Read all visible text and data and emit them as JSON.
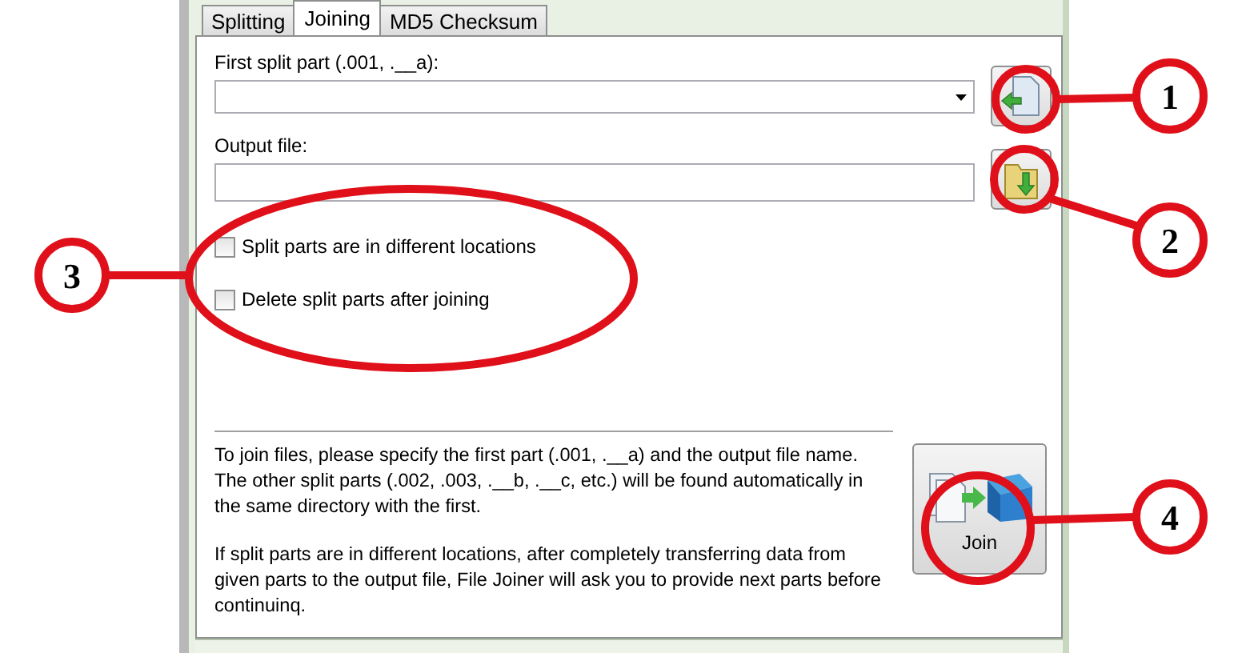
{
  "tabs": [
    {
      "label": "Splitting",
      "selected": false
    },
    {
      "label": "Joining",
      "selected": true
    },
    {
      "label": "MD5 Checksum",
      "selected": false
    }
  ],
  "first_part": {
    "label": "First split part (.001, .__a):"
  },
  "output_file": {
    "label": "Output file:"
  },
  "options": [
    {
      "label": "Split parts are in different locations",
      "checked": false
    },
    {
      "label": "Delete split parts after joining",
      "checked": false
    }
  ],
  "help_text": [
    "To join files, please specify the first part (.001, .__a) and the output file name. The other split parts (.002, .003, .__b, .__c, etc.) will be found automatically in the same directory with the first.",
    "If split parts are in different locations, after completely transferring data from given parts to the output file, File Joiner will ask you to provide next parts before continuinq."
  ],
  "join_button": {
    "label": "Join"
  },
  "annotations": [
    {
      "label": "1"
    },
    {
      "label": "2"
    },
    {
      "label": "3"
    },
    {
      "label": "4"
    }
  ]
}
